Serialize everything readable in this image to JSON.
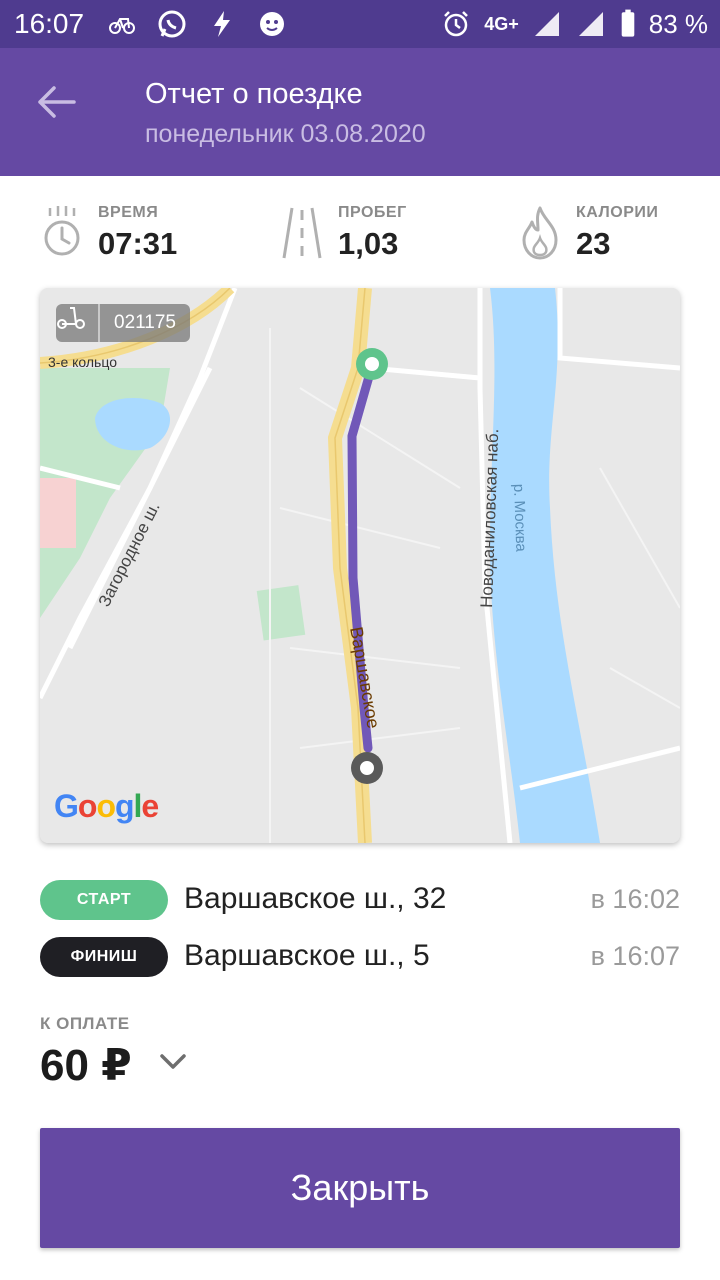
{
  "status_bar": {
    "time": "16:07",
    "network": "4G+",
    "battery_percent": "83 %",
    "icons_left": [
      "bike-icon",
      "whatsapp-icon",
      "bolt-icon",
      "shield-icon"
    ],
    "icons_right": [
      "alarm-icon",
      "network-icon",
      "signal-icon",
      "signal-icon",
      "battery-icon"
    ]
  },
  "header": {
    "title": "Отчет о поездке",
    "subtitle": "понедельник 03.08.2020",
    "back_icon": "arrow-left-icon"
  },
  "stats": [
    {
      "label": "ВРЕМЯ",
      "value": "07:31",
      "icon": "stopwatch-icon"
    },
    {
      "label": "ПРОБЕГ",
      "value": "1,03",
      "icon": "road-icon"
    },
    {
      "label": "КАЛОРИИ",
      "value": "23",
      "icon": "flame-icon"
    }
  ],
  "map": {
    "scooter_id": "021175",
    "labels": {
      "ring": "3-е кольцо",
      "zagorodnoe": "Загородное ш.",
      "novodanilovskaya": "Новоданиловская наб.",
      "river": "р. Москва",
      "varshavskoe": "Варшавское"
    },
    "google_logo": "Google",
    "colors": {
      "route": "#7158b8",
      "water": "#aadaff",
      "park": "#c3e6cb",
      "road_major": "#f5dd90"
    }
  },
  "route": {
    "start": {
      "tag": "СТАРТ",
      "address": "Варшавское ш., 32",
      "time": "в 16:02"
    },
    "finish": {
      "tag": "ФИНИШ",
      "address": "Варшавское ш., 5",
      "time": "в 16:07"
    }
  },
  "payment": {
    "label": "К ОПЛАТЕ",
    "amount": "60 ₽"
  },
  "close_button": {
    "label": "Закрыть"
  },
  "colors": {
    "primary": "#6549a3",
    "status_bar": "#4f3b8f",
    "start": "#5fc48c",
    "finish": "#1f1f24"
  }
}
